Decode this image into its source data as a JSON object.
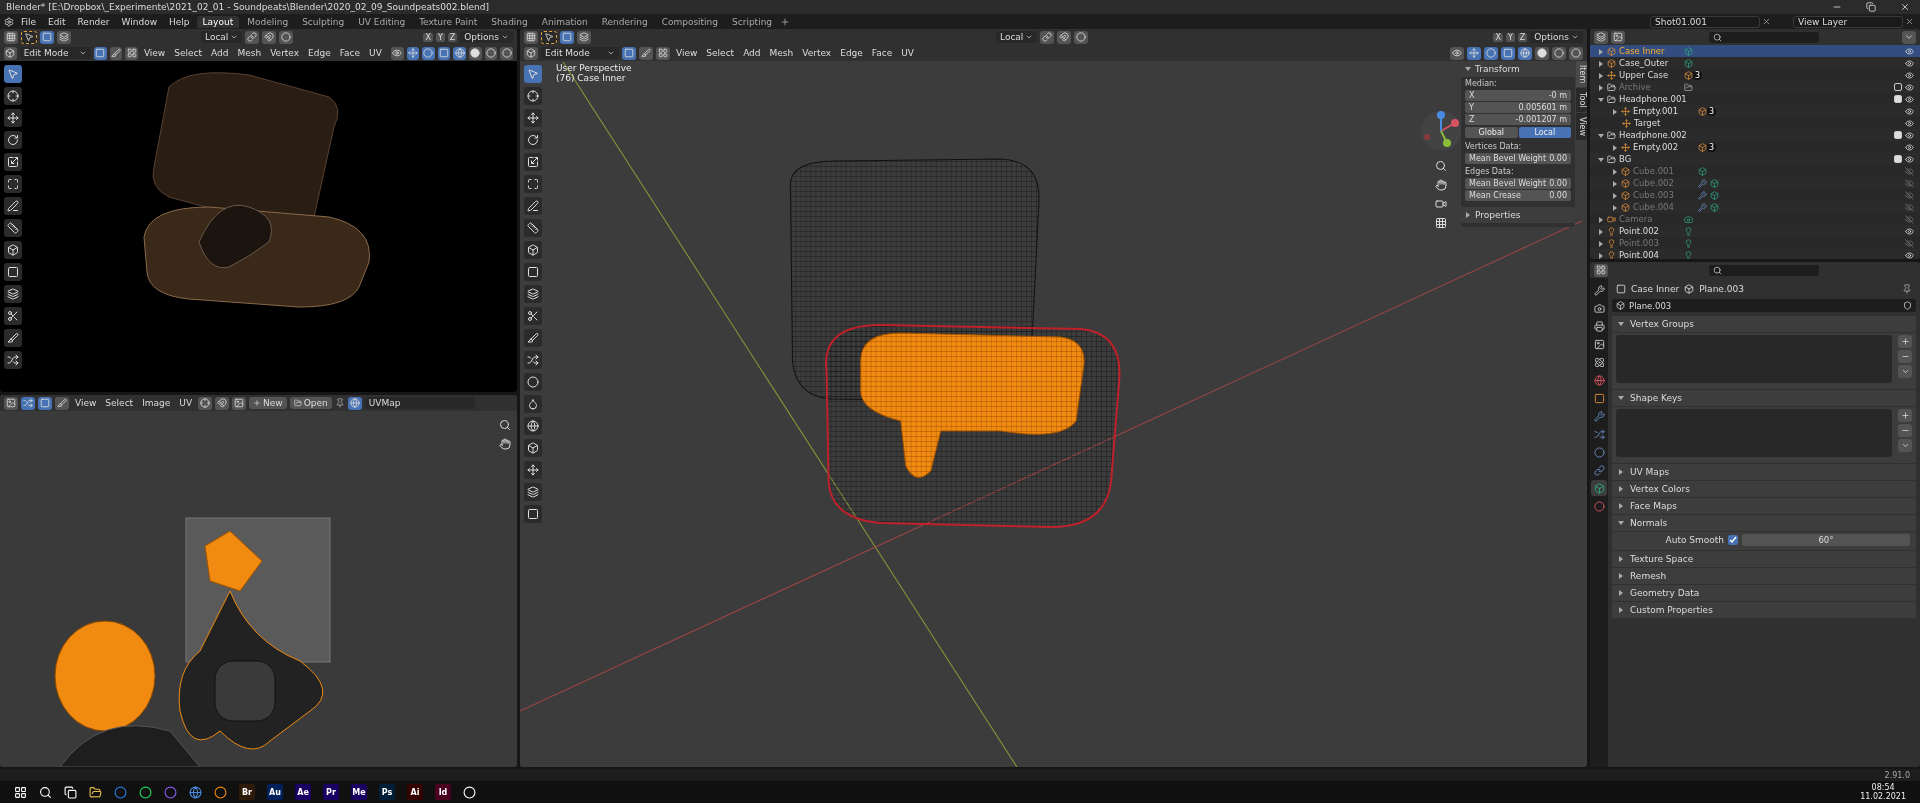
{
  "window": {
    "title": "Blender* [E:\\Dropbox\\_Experimente\\2021_02_01 - Soundpeats\\Blender\\2020_02_09_Soundpeats002.blend]"
  },
  "menu": [
    "File",
    "Edit",
    "Render",
    "Window",
    "Help"
  ],
  "workspaces": [
    {
      "label": "Layout",
      "selected": true
    },
    {
      "label": "Modeling",
      "selected": false
    },
    {
      "label": "Sculpting",
      "selected": false
    },
    {
      "label": "UV Editing",
      "selected": false
    },
    {
      "label": "Texture Paint",
      "selected": false
    },
    {
      "label": "Shading",
      "selected": false
    },
    {
      "label": "Animation",
      "selected": false
    },
    {
      "label": "Rendering",
      "selected": false
    },
    {
      "label": "Compositing",
      "selected": false
    },
    {
      "label": "Scripting",
      "selected": false
    }
  ],
  "scene": {
    "name": "Shot01.001"
  },
  "view_layer": {
    "name": "View Layer"
  },
  "render_view": {
    "orientation": "Local",
    "axes": [
      "X",
      "Y",
      "Z"
    ],
    "options": "Options",
    "mode": "Edit Mode",
    "menus": [
      "View",
      "Select",
      "Add",
      "Mesh",
      "Vertex",
      "Edge",
      "Face",
      "UV"
    ]
  },
  "uv_editor": {
    "menus": [
      "View",
      "Select",
      "Image",
      "UV"
    ],
    "new": "New",
    "open": "Open",
    "uv_map": "UVMap"
  },
  "viewport": {
    "orientation": "Local",
    "axes": [
      "X",
      "Y",
      "Z"
    ],
    "options": "Options",
    "mode": "Edit Mode",
    "menus": [
      "View",
      "Select",
      "Add",
      "Mesh",
      "Vertex",
      "Edge",
      "Face",
      "UV"
    ],
    "overlay_text": [
      "User Perspective",
      "(76) Case Inner"
    ],
    "side_tabs": [
      {
        "label": "Item",
        "selected": true
      },
      {
        "label": "Tool",
        "selected": false
      },
      {
        "label": "View",
        "selected": false
      }
    ],
    "transform": {
      "title": "Transform",
      "median": "Median:",
      "coords": [
        {
          "axis": "X",
          "value": "-0 m"
        },
        {
          "axis": "Y",
          "value": "0.005601 m"
        },
        {
          "axis": "Z",
          "value": "-0.001207 m"
        }
      ],
      "spaces": [
        {
          "label": "Global",
          "selected": false
        },
        {
          "label": "Local",
          "selected": true
        }
      ],
      "groups": [
        {
          "title": "Vertices Data:",
          "fields": [
            {
              "label": "Mean Bevel Weight",
              "value": "0.00"
            }
          ]
        },
        {
          "title": "Edges Data:",
          "fields": [
            {
              "label": "Mean Bevel Weight",
              "value": "0.00"
            },
            {
              "label": "Mean Crease",
              "value": "0.00"
            }
          ]
        }
      ]
    },
    "properties_panel": {
      "title": "Properties",
      "expanded": false
    }
  },
  "outliner": {
    "items": [
      {
        "name": "Case Inner",
        "kind": "mesh",
        "selected": true,
        "expanded": false,
        "visible": true,
        "data": [
          {
            "kind": "mesh_data"
          }
        ]
      },
      {
        "name": "Case_Outer",
        "kind": "mesh",
        "selected": false,
        "expanded": false,
        "visible": true,
        "data": [
          {
            "kind": "mesh_data"
          }
        ]
      },
      {
        "name": "Upper Case",
        "kind": "empty",
        "selected": false,
        "expanded": false,
        "visible": true,
        "data": [
          {
            "kind": "mesh",
            "count": "3"
          }
        ]
      },
      {
        "name": "Archive",
        "kind": "collection",
        "selected": false,
        "expanded": false,
        "visible": true,
        "checked": false,
        "data": [
          {
            "kind": "collection"
          }
        ]
      },
      {
        "name": "Headphone.001",
        "kind": "collection",
        "selected": false,
        "expanded": true,
        "visible": true,
        "checked": true,
        "children": [
          {
            "name": "Empty.001",
            "kind": "empty",
            "selected": false,
            "expanded": false,
            "visible": true,
            "data": [
              {
                "kind": "mesh",
                "count": "3"
              }
            ]
          },
          {
            "name": "Target",
            "kind": "empty",
            "selected": false,
            "visible": true
          }
        ]
      },
      {
        "name": "Headphone.002",
        "kind": "collection",
        "selected": false,
        "expanded": true,
        "visible": true,
        "checked": true,
        "children": [
          {
            "name": "Empty.002",
            "kind": "empty",
            "selected": false,
            "expanded": false,
            "visible": true,
            "data": [
              {
                "kind": "mesh",
                "count": "3"
              }
            ]
          }
        ]
      },
      {
        "name": "BG",
        "kind": "collection",
        "selected": false,
        "expanded": true,
        "visible": true,
        "checked": true,
        "children": [
          {
            "name": "Cube.001",
            "kind": "mesh",
            "selected": false,
            "expanded": false,
            "visible": false,
            "data": [
              {
                "kind": "mesh_data"
              }
            ]
          },
          {
            "name": "Cube.002",
            "kind": "mesh",
            "selected": false,
            "expanded": false,
            "visible": false,
            "data": [
              {
                "kind": "modifier"
              },
              {
                "kind": "mesh_data"
              }
            ]
          },
          {
            "name": "Cube.003",
            "kind": "mesh",
            "selected": false,
            "expanded": false,
            "visible": false,
            "data": [
              {
                "kind": "modifier"
              },
              {
                "kind": "mesh_data"
              }
            ]
          },
          {
            "name": "Cube.004",
            "kind": "mesh",
            "selected": false,
            "expanded": false,
            "visible": false,
            "data": [
              {
                "kind": "modifier"
              },
              {
                "kind": "mesh_data"
              }
            ]
          }
        ]
      },
      {
        "name": "Camera",
        "kind": "camera",
        "selected": false,
        "expanded": false,
        "visible": false,
        "data": [
          {
            "kind": "camera_data"
          }
        ]
      },
      {
        "name": "Point.002",
        "kind": "light",
        "selected": false,
        "expanded": false,
        "visible": true,
        "data": [
          {
            "kind": "light_data"
          }
        ]
      },
      {
        "name": "Point.003",
        "kind": "light",
        "selected": false,
        "expanded": false,
        "visible": false,
        "data": [
          {
            "kind": "light_data"
          }
        ]
      },
      {
        "name": "Point.004",
        "kind": "light",
        "selected": false,
        "expanded": false,
        "visible": true,
        "data": [
          {
            "kind": "light_data"
          }
        ]
      }
    ]
  },
  "properties": {
    "tabs": [
      {
        "kind": "tool",
        "selected": false
      },
      {
        "kind": "render",
        "selected": false
      },
      {
        "kind": "output",
        "selected": false
      },
      {
        "kind": "view_layer",
        "selected": false
      },
      {
        "kind": "scene",
        "selected": false
      },
      {
        "kind": "world",
        "selected": false
      },
      {
        "kind": "object",
        "selected": false
      },
      {
        "kind": "modifiers",
        "selected": false
      },
      {
        "kind": "particles",
        "selected": false
      },
      {
        "kind": "physics",
        "selected": false
      },
      {
        "kind": "constraints",
        "selected": false
      },
      {
        "kind": "data",
        "selected": true
      },
      {
        "kind": "material",
        "selected": false
      }
    ],
    "object": "Case Inner",
    "data_name": "Plane.003",
    "datablock": "Plane.003",
    "panels": [
      {
        "title": "Vertex Groups",
        "kind": "list",
        "expanded": true
      },
      {
        "title": "Shape Keys",
        "kind": "list",
        "expanded": true
      },
      {
        "title": "UV Maps",
        "expanded": false
      },
      {
        "title": "Vertex Colors",
        "expanded": false
      },
      {
        "title": "Face Maps",
        "expanded": false
      },
      {
        "title": "Normals",
        "kind": "normals",
        "expanded": true,
        "auto_smooth": {
          "label": "Auto Smooth",
          "checked": true,
          "angle": "60°"
        }
      },
      {
        "title": "Texture Space",
        "expanded": false
      },
      {
        "title": "Remesh",
        "expanded": false
      },
      {
        "title": "Geometry Data",
        "expanded": false
      },
      {
        "title": "Custom Properties",
        "expanded": false
      }
    ]
  },
  "status_bar": {
    "version": "2.91.0"
  },
  "taskbar": {
    "apps": [
      {
        "label": "Br",
        "color": "#2e1a08"
      },
      {
        "label": "Au",
        "color": "#00205a"
      },
      {
        "label": "Ae",
        "color": "#1a0060"
      },
      {
        "label": "Pr",
        "color": "#1a0060"
      },
      {
        "label": "Me",
        "color": "#1a0060"
      },
      {
        "label": "Ps",
        "color": "#001e36"
      },
      {
        "label": "Ai",
        "color": "#330000"
      },
      {
        "label": "Id",
        "color": "#49021f"
      }
    ],
    "time": "08:54",
    "date": "11.02.2021"
  }
}
